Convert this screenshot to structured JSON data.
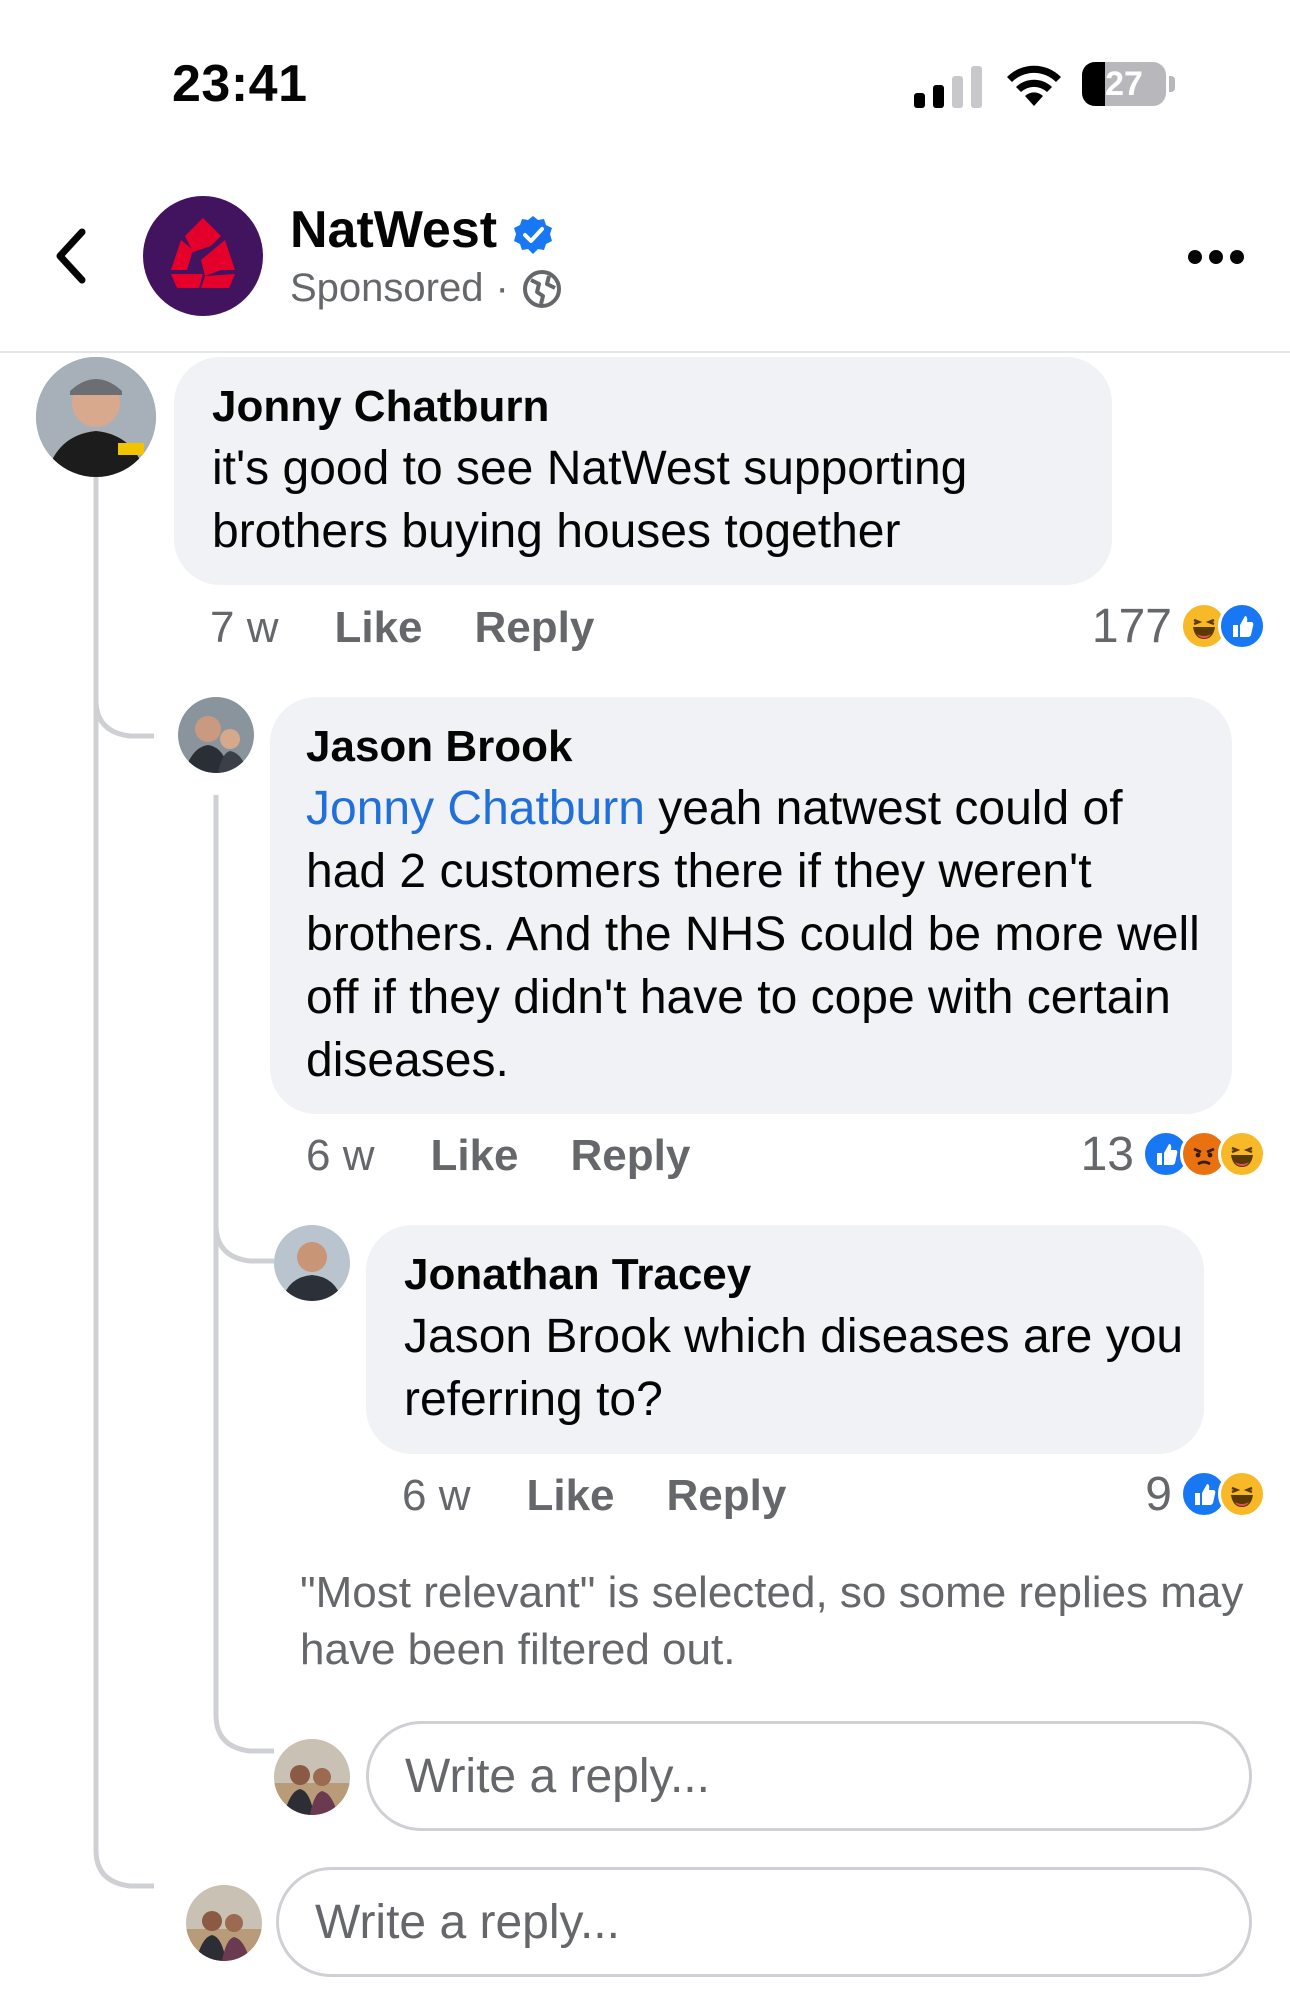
{
  "status_bar": {
    "time": "23:41",
    "battery_level": "27",
    "battery_fraction": 0.27
  },
  "header": {
    "page_name": "NatWest",
    "sponsored_label": "Sponsored",
    "separator": "·",
    "icons": [
      "back-chevron-icon",
      "natwest-logo",
      "verified-badge-icon",
      "globe-icon",
      "more-options-icon"
    ]
  },
  "comments": [
    {
      "author": "Jonny Chatburn",
      "text": "it's good to see NatWest supporting brothers buying houses together",
      "time": "7 w",
      "like_label": "Like",
      "reply_label": "Reply",
      "reaction_count": "177",
      "reactions": [
        "haha",
        "like"
      ]
    },
    {
      "author": "Jason Brook",
      "mention": "Jonny Chatburn",
      "text": " yeah natwest could of had 2 customers there if they weren't brothers. And the NHS could be more well off if they didn't have to cope with certain diseases.",
      "time": "6 w",
      "like_label": "Like",
      "reply_label": "Reply",
      "reaction_count": "13",
      "reactions": [
        "like",
        "angry",
        "haha"
      ]
    },
    {
      "author": "Jonathan Tracey",
      "text": "Jason Brook which diseases are you referring to?",
      "time": "6 w",
      "like_label": "Like",
      "reply_label": "Reply",
      "reaction_count": "9",
      "reactions": [
        "like",
        "haha"
      ]
    }
  ],
  "filter_note": "\"Most relevant\" is selected, so some replies may have been filtered out.",
  "reply_inputs": {
    "placeholder": "Write a reply..."
  },
  "colors": {
    "mention": "#216fdb",
    "bubble": "#f0f2f5",
    "natwest_purple": "#42145f",
    "natwest_red": "#e4002b"
  }
}
